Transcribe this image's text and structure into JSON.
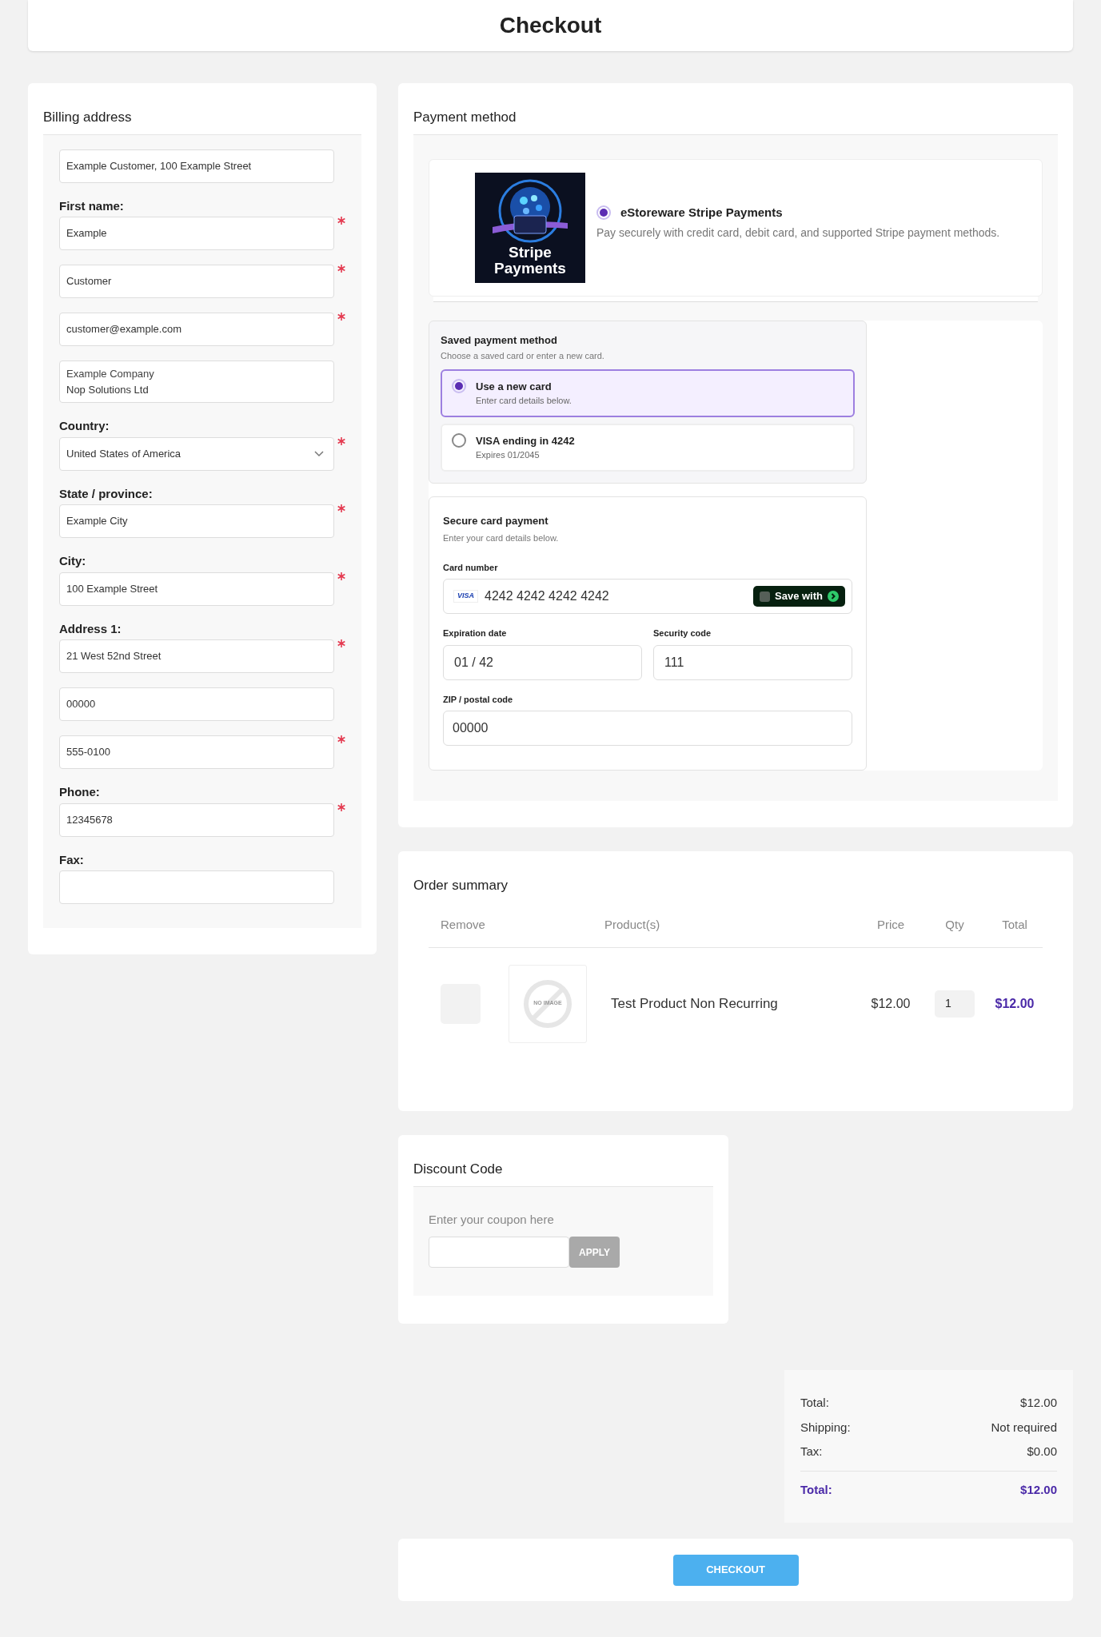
{
  "page_title": "Checkout",
  "billing": {
    "title": "Billing address",
    "fields": [
      {
        "kind": "input",
        "value": "Example Customer, 100 Example Street",
        "required": false
      },
      {
        "kind": "input",
        "label": "First name:",
        "value": "Example",
        "required": true
      },
      {
        "kind": "input",
        "value": "Customer",
        "required": true
      },
      {
        "kind": "input",
        "value": "customer@example.com",
        "required": true
      },
      {
        "kind": "input",
        "caption": "Example Company",
        "value": "Nop Solutions Ltd",
        "required": false
      },
      {
        "kind": "select",
        "label": "Country:",
        "value": "United States of America",
        "required": true
      },
      {
        "kind": "input",
        "label": "State / province:",
        "value": "Example City",
        "required": true
      },
      {
        "kind": "input",
        "label": "City:",
        "value": "100 Example Street",
        "required": true
      },
      {
        "kind": "input",
        "label": "Address 1:",
        "value": "21 West 52nd Street",
        "required": true
      },
      {
        "kind": "input",
        "value": "00000",
        "required": false
      },
      {
        "kind": "input",
        "value": "555-0100",
        "required": true
      },
      {
        "kind": "input",
        "label": "Phone:",
        "value": "12345678",
        "required": true
      },
      {
        "kind": "input",
        "label": "Fax:",
        "required": false
      }
    ]
  },
  "payment": {
    "title": "Payment method",
    "method": {
      "logo_text": "Stripe Payments",
      "name": "eStoreware Stripe Payments",
      "description": "Pay securely with credit card, debit card, and supported Stripe payment methods.",
      "selected": true
    },
    "saved": {
      "title": "Saved payment method",
      "subtitle": "Choose a saved card or enter a new card.",
      "options": [
        {
          "title": "Use a new card",
          "detail": "Enter card details below.",
          "selected": true
        },
        {
          "title": "VISA ending in 4242",
          "detail": "Expires 01/2045",
          "selected": false
        }
      ]
    },
    "card_form": {
      "title": "Secure card payment",
      "subtitle": "Enter your card details below.",
      "card_number": {
        "label": "Card number",
        "brand": "VISA",
        "value": "4242 4242 4242 4242",
        "save_label": "Save with",
        "save_checked": false
      },
      "expiration": {
        "label": "Expiration date",
        "value": "01 / 42"
      },
      "security": {
        "label": "Security code",
        "value": "111"
      },
      "zip": {
        "label": "ZIP / postal code",
        "value": "00000"
      }
    }
  },
  "order": {
    "title": "Order summary",
    "columns": [
      "Remove",
      "Product(s)",
      "Price",
      "Qty",
      "Total"
    ],
    "rows": [
      {
        "remove": false,
        "image_text": "NO IMAGE",
        "product": "Test Product Non Recurring",
        "price": "$12.00",
        "qty": "1",
        "total": "$12.00"
      }
    ]
  },
  "discount": {
    "title": "Discount Code",
    "prompt": "Enter your coupon here",
    "button": "APPLY"
  },
  "totals": [
    {
      "kind": "line",
      "label": "Total:",
      "value": "$12.00"
    },
    {
      "kind": "line",
      "label": "Shipping:",
      "value": "Not required"
    },
    {
      "kind": "line",
      "label": "Tax:",
      "value": "$0.00"
    },
    {
      "kind": "grand",
      "label": "Total:",
      "value": "$12.00"
    }
  ],
  "checkout_button": "CHECKOUT"
}
